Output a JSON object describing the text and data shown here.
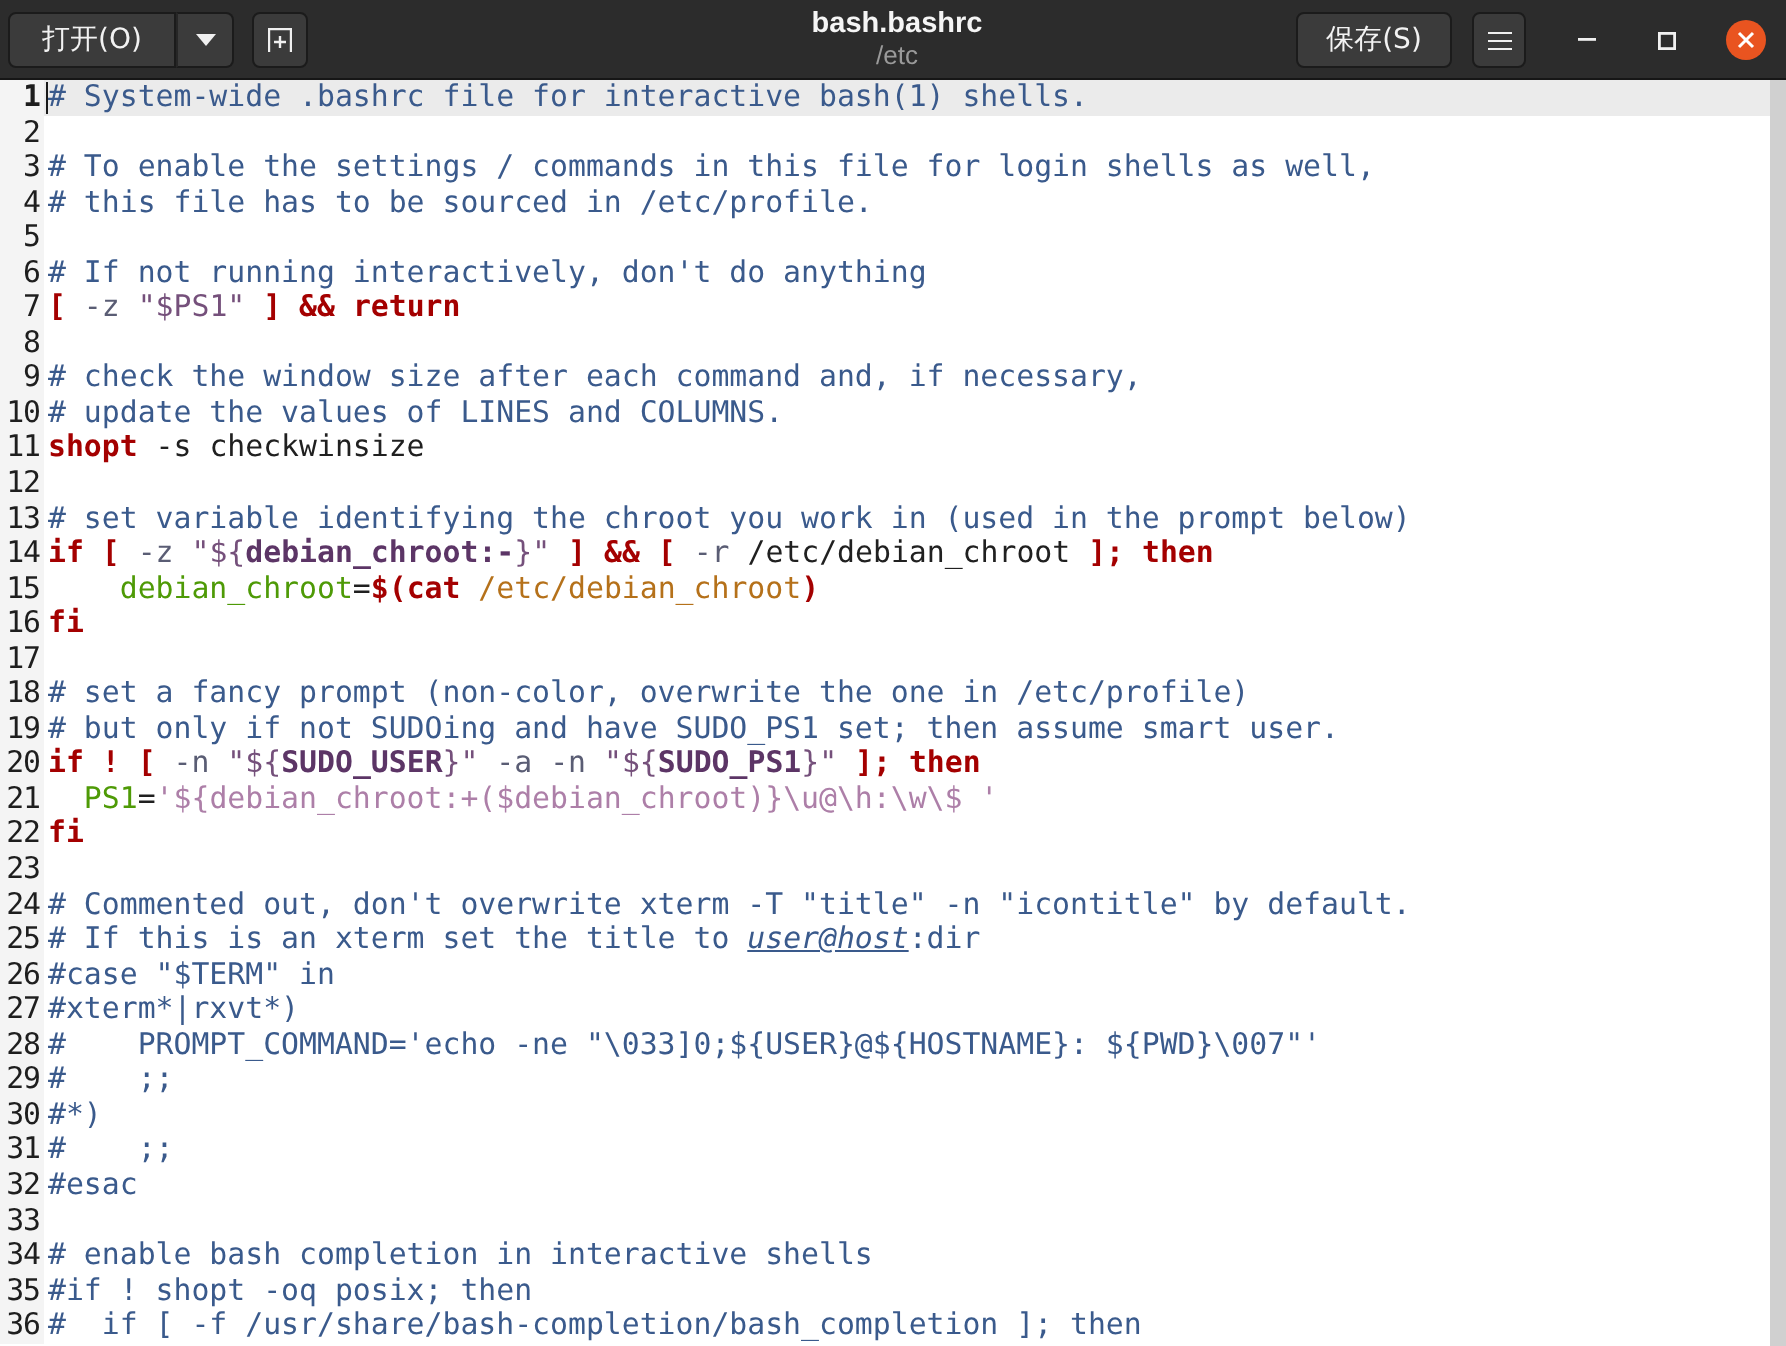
{
  "header": {
    "open_button": "打开(O)",
    "title": "bash.bashrc",
    "subtitle": "/etc",
    "save_button": "保存(S)"
  },
  "editor": {
    "lines": [
      {
        "number": "1",
        "current": true,
        "tokens": [
          {
            "kind": "comment",
            "text": "# System-wide .bashrc file for interactive bash(1) shells."
          }
        ]
      },
      {
        "number": "2",
        "current": false
      },
      {
        "number": "3",
        "current": false,
        "tokens": [
          {
            "kind": "comment",
            "text": "# To enable the settings / commands in this file for login shells as well,"
          }
        ]
      },
      {
        "number": "4",
        "current": false,
        "tokens": [
          {
            "kind": "comment",
            "text": "# this file has to be sourced in /etc/profile."
          }
        ]
      },
      {
        "number": "5",
        "current": false
      },
      {
        "number": "6",
        "current": false,
        "tokens": [
          {
            "kind": "comment",
            "text": "# If not running interactively, don't do anything"
          }
        ]
      },
      {
        "number": "7",
        "current": false,
        "tokens": [
          {
            "kind": "keyword",
            "text": "["
          },
          {
            "kind": "option",
            "text": " -z"
          },
          {
            "kind": "string",
            "text": " \"$PS1\""
          },
          {
            "kind": "keyword",
            "text": " ]"
          },
          {
            "kind": "keyword",
            "text": " &&"
          },
          {
            "kind": "keyword",
            "text": " return"
          }
        ]
      },
      {
        "number": "8",
        "current": false
      },
      {
        "number": "9",
        "current": false,
        "tokens": [
          {
            "kind": "comment",
            "text": "# check the window size after each command and, if necessary,"
          }
        ]
      },
      {
        "number": "10",
        "current": false,
        "tokens": [
          {
            "kind": "comment",
            "text": "# update the values of LINES and COLUMNS."
          }
        ]
      },
      {
        "number": "11",
        "current": false,
        "tokens": [
          {
            "kind": "keyword",
            "text": "shopt"
          },
          {
            "kind": "plain",
            "text": " -s checkwinsize"
          }
        ]
      },
      {
        "number": "12",
        "current": false
      },
      {
        "number": "13",
        "current": false,
        "tokens": [
          {
            "kind": "comment",
            "text": "# set variable identifying the chroot you work in (used in the prompt below)"
          }
        ]
      },
      {
        "number": "14",
        "current": false,
        "tokens": [
          {
            "kind": "keyword",
            "text": "if"
          },
          {
            "kind": "keyword",
            "text": " ["
          },
          {
            "kind": "option",
            "text": " -z"
          },
          {
            "kind": "string",
            "text": " \"${"
          },
          {
            "kind": "expansion",
            "text": "debian_chroot:-"
          },
          {
            "kind": "string",
            "text": "}\""
          },
          {
            "kind": "keyword",
            "text": " ]"
          },
          {
            "kind": "keyword",
            "text": " &&"
          },
          {
            "kind": "keyword",
            "text": " ["
          },
          {
            "kind": "option",
            "text": " -r"
          },
          {
            "kind": "plain",
            "text": " /etc/debian_chroot "
          },
          {
            "kind": "keyword",
            "text": "];"
          },
          {
            "kind": "keyword",
            "text": " then"
          }
        ]
      },
      {
        "number": "15",
        "current": false,
        "tokens": [
          {
            "kind": "variable",
            "text": "    debian_chroot"
          },
          {
            "kind": "plain",
            "text": "="
          },
          {
            "kind": "keyword",
            "text": "$("
          },
          {
            "kind": "keyword",
            "text": "cat"
          },
          {
            "kind": "path",
            "text": " /etc/debian_chroot"
          },
          {
            "kind": "keyword",
            "text": ")"
          }
        ]
      },
      {
        "number": "16",
        "current": false,
        "tokens": [
          {
            "kind": "keyword",
            "text": "fi"
          }
        ]
      },
      {
        "number": "17",
        "current": false
      },
      {
        "number": "18",
        "current": false,
        "tokens": [
          {
            "kind": "comment",
            "text": "# set a fancy prompt (non-color, overwrite the one in /etc/profile)"
          }
        ]
      },
      {
        "number": "19",
        "current": false,
        "tokens": [
          {
            "kind": "comment",
            "text": "# but only if not SUDOing and have SUDO_PS1 set; then assume smart user."
          }
        ]
      },
      {
        "number": "20",
        "current": false,
        "tokens": [
          {
            "kind": "keyword",
            "text": "if"
          },
          {
            "kind": "keyword",
            "text": " !"
          },
          {
            "kind": "keyword",
            "text": " ["
          },
          {
            "kind": "option",
            "text": " -n"
          },
          {
            "kind": "string",
            "text": " \"${"
          },
          {
            "kind": "expansion",
            "text": "SUDO_USER"
          },
          {
            "kind": "string",
            "text": "}\""
          },
          {
            "kind": "option",
            "text": " -a"
          },
          {
            "kind": "option",
            "text": " -n"
          },
          {
            "kind": "string",
            "text": " \"${"
          },
          {
            "kind": "expansion",
            "text": "SUDO_PS1"
          },
          {
            "kind": "string",
            "text": "}\""
          },
          {
            "kind": "keyword",
            "text": " ];"
          },
          {
            "kind": "keyword",
            "text": " then"
          }
        ]
      },
      {
        "number": "21",
        "current": false,
        "tokens": [
          {
            "kind": "variable",
            "text": "  PS1"
          },
          {
            "kind": "plain",
            "text": "="
          },
          {
            "kind": "quoted",
            "text": "'${debian_chroot:+($debian_chroot)}\\u@\\h:\\w\\$ '"
          }
        ]
      },
      {
        "number": "22",
        "current": false,
        "tokens": [
          {
            "kind": "keyword",
            "text": "fi"
          }
        ]
      },
      {
        "number": "23",
        "current": false
      },
      {
        "number": "24",
        "current": false,
        "tokens": [
          {
            "kind": "comment",
            "text": "# Commented out, don't overwrite xterm -T \"title\" -n \"icontitle\" by default."
          }
        ]
      },
      {
        "number": "25",
        "current": false,
        "tokens": [
          {
            "kind": "comment",
            "text": "# If this is an xterm set the title to "
          },
          {
            "kind": "email",
            "text": "user@host"
          },
          {
            "kind": "comment",
            "text": ":dir"
          }
        ]
      },
      {
        "number": "26",
        "current": false,
        "tokens": [
          {
            "kind": "comment",
            "text": "#case \"$TERM\" in"
          }
        ]
      },
      {
        "number": "27",
        "current": false,
        "tokens": [
          {
            "kind": "comment",
            "text": "#xterm*|rxvt*)"
          }
        ]
      },
      {
        "number": "28",
        "current": false,
        "tokens": [
          {
            "kind": "comment",
            "text": "#    PROMPT_COMMAND='echo -ne \"\\033]0;${USER}@${HOSTNAME}: ${PWD}\\007\"'"
          }
        ]
      },
      {
        "number": "29",
        "current": false,
        "tokens": [
          {
            "kind": "comment",
            "text": "#    ;;"
          }
        ]
      },
      {
        "number": "30",
        "current": false,
        "tokens": [
          {
            "kind": "comment",
            "text": "#*)"
          }
        ]
      },
      {
        "number": "31",
        "current": false,
        "tokens": [
          {
            "kind": "comment",
            "text": "#    ;;"
          }
        ]
      },
      {
        "number": "32",
        "current": false,
        "tokens": [
          {
            "kind": "comment",
            "text": "#esac"
          }
        ]
      },
      {
        "number": "33",
        "current": false
      },
      {
        "number": "34",
        "current": false,
        "tokens": [
          {
            "kind": "comment",
            "text": "# enable bash completion in interactive shells"
          }
        ]
      },
      {
        "number": "35",
        "current": false,
        "tokens": [
          {
            "kind": "comment",
            "text": "#if ! shopt -oq posix; then"
          }
        ]
      },
      {
        "number": "36",
        "current": false,
        "tokens": [
          {
            "kind": "comment",
            "text": "#  if [ -f /usr/share/bash-completion/bash_completion ]; then"
          }
        ]
      }
    ]
  }
}
